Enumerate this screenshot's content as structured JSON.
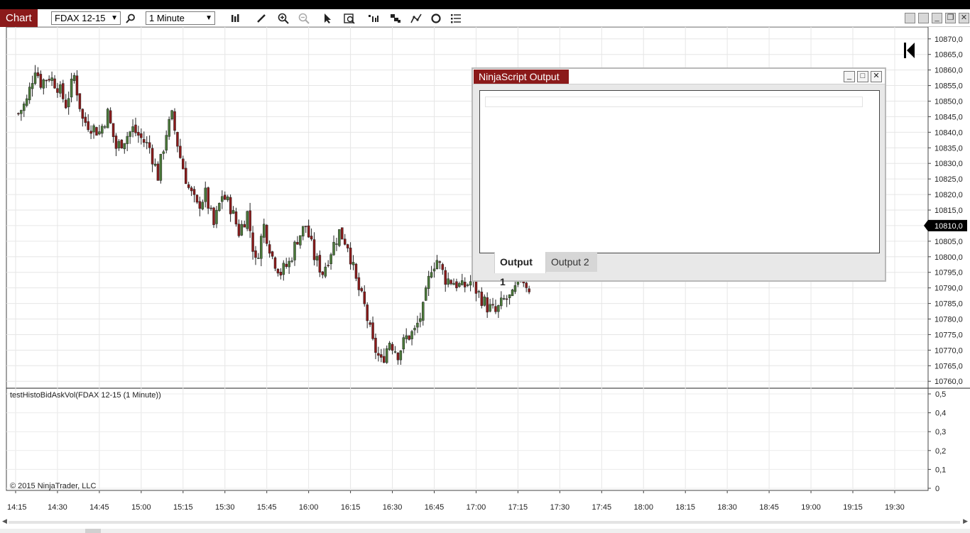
{
  "toolbar": {
    "chart_tab": "Chart",
    "instrument": "FDAX 12-15",
    "interval": "1 Minute",
    "icons": [
      "search-icon",
      "bar-type-icon",
      "pencil-draw-icon",
      "zoom-in-icon",
      "zoom-out-icon",
      "pointer-icon",
      "data-box-icon",
      "indicators-icon",
      "strategies-icon",
      "draw-lines-icon",
      "reload-icon",
      "properties-icon"
    ],
    "window_buttons": [
      "tile",
      "tile-2",
      "minimize",
      "restore",
      "close"
    ]
  },
  "chart_data": {
    "type": "candlestick",
    "instrument": "FDAX 12-15",
    "price_axis_labels": [
      "10870,0",
      "10865,0",
      "10860,0",
      "10855,0",
      "10850,0",
      "10845,0",
      "10840,0",
      "10835,0",
      "10830,0",
      "10825,0",
      "10820,0",
      "10815,0",
      "10810,0",
      "10805,0",
      "10800,0",
      "10795,0",
      "10790,0",
      "10785,0",
      "10780,0",
      "10775,0",
      "10770,0",
      "10765,0",
      "10760,0"
    ],
    "ylim": [
      10758,
      10872
    ],
    "last_price_label": "10810,0",
    "time_axis_labels": [
      "14:15",
      "14:30",
      "14:45",
      "15:00",
      "15:15",
      "15:30",
      "15:45",
      "16:00",
      "16:15",
      "16:30",
      "16:45",
      "17:00",
      "17:15",
      "17:30",
      "17:45",
      "18:00",
      "18:15",
      "18:30",
      "18:45",
      "19:00",
      "19:15",
      "19:30"
    ],
    "close_path": [
      [
        "14:16",
        10846
      ],
      [
        "14:19",
        10850
      ],
      [
        "14:22",
        10861
      ],
      [
        "14:24",
        10856
      ],
      [
        "14:27",
        10858
      ],
      [
        "14:30",
        10855
      ],
      [
        "14:33",
        10849
      ],
      [
        "14:36",
        10858
      ],
      [
        "14:39",
        10844
      ],
      [
        "14:42",
        10842
      ],
      [
        "14:45",
        10840
      ],
      [
        "14:48",
        10846
      ],
      [
        "14:51",
        10835
      ],
      [
        "14:54",
        10838
      ],
      [
        "14:57",
        10841
      ],
      [
        "15:00",
        10838
      ],
      [
        "15:03",
        10835
      ],
      [
        "15:06",
        10826
      ],
      [
        "15:09",
        10840
      ],
      [
        "15:11",
        10845
      ],
      [
        "15:14",
        10832
      ],
      [
        "15:17",
        10822
      ],
      [
        "15:20",
        10816
      ],
      [
        "15:23",
        10820
      ],
      [
        "15:26",
        10810
      ],
      [
        "15:29",
        10820
      ],
      [
        "15:32",
        10816
      ],
      [
        "15:35",
        10808
      ],
      [
        "15:38",
        10814
      ],
      [
        "15:41",
        10798
      ],
      [
        "15:44",
        10810
      ],
      [
        "15:47",
        10800
      ],
      [
        "15:50",
        10795
      ],
      [
        "15:53",
        10798
      ],
      [
        "15:56",
        10806
      ],
      [
        "15:59",
        10810
      ],
      [
        "16:02",
        10800
      ],
      [
        "16:05",
        10795
      ],
      [
        "16:08",
        10802
      ],
      [
        "16:11",
        10808
      ],
      [
        "16:14",
        10804
      ],
      [
        "16:17",
        10792
      ],
      [
        "16:20",
        10784
      ],
      [
        "16:23",
        10772
      ],
      [
        "16:26",
        10766
      ],
      [
        "16:29",
        10773
      ],
      [
        "16:32",
        10769
      ],
      [
        "16:35",
        10774
      ],
      [
        "16:38",
        10776
      ],
      [
        "16:41",
        10783
      ],
      [
        "16:44",
        10797
      ],
      [
        "16:46",
        10799
      ],
      [
        "16:49",
        10793
      ],
      [
        "16:52",
        10792
      ],
      [
        "16:55",
        10790
      ],
      [
        "16:58",
        10792
      ],
      [
        "17:01",
        10788
      ],
      [
        "17:04",
        10784
      ],
      [
        "17:07",
        10782
      ],
      [
        "17:10",
        10786
      ],
      [
        "17:13",
        10787
      ],
      [
        "17:16",
        10794
      ],
      [
        "17:19",
        10790
      ]
    ],
    "indicator": {
      "label": "testHistoBidAskVol(FDAX 12-15 (1 Minute))",
      "axis_labels": [
        "0,5",
        "0,4",
        "0,3",
        "0,2",
        "0,1",
        "0"
      ],
      "ylim": [
        0,
        0.5
      ]
    },
    "grid": true
  },
  "copyright": "© 2015 NinjaTrader, LLC",
  "ninjascript_output": {
    "title": "NinjaScript Output",
    "tabs": [
      "Output 1",
      "Output 2"
    ],
    "active_tab": "Output 1",
    "content": ""
  }
}
